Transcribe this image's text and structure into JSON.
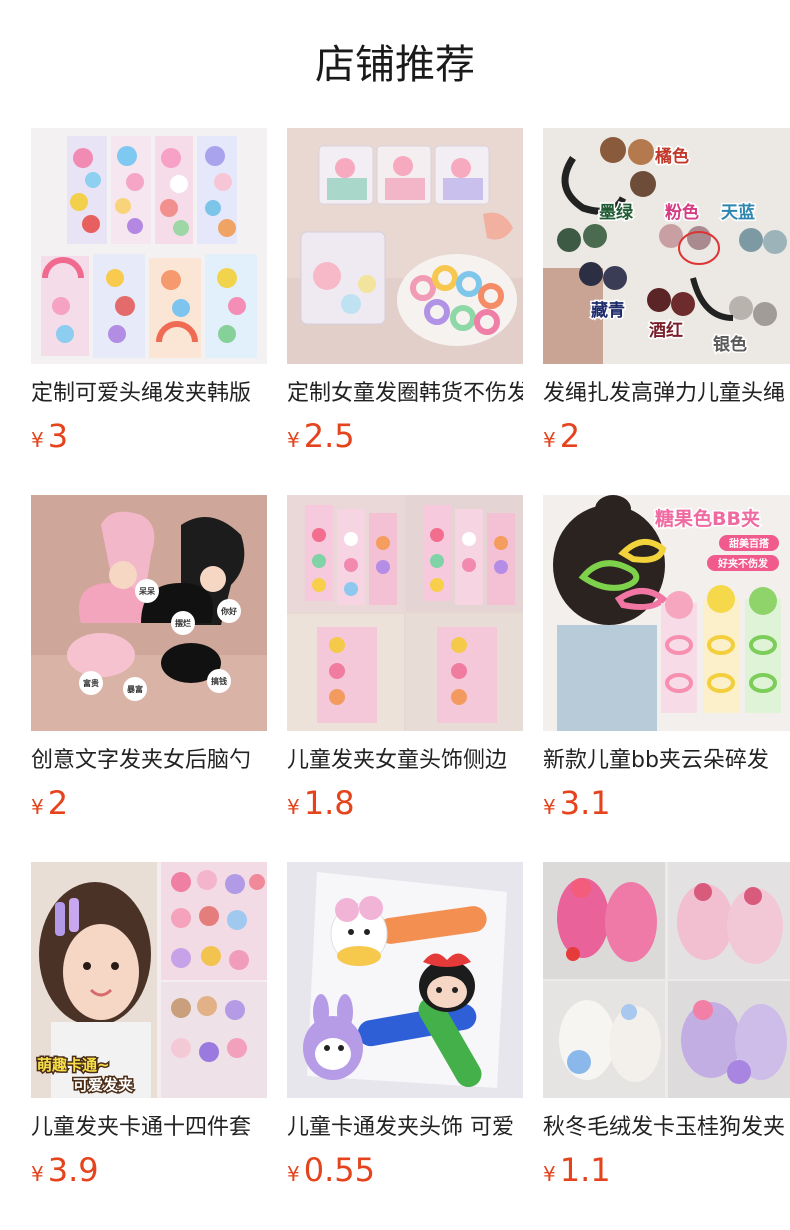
{
  "header": {
    "title": "店铺推荐"
  },
  "currency": "¥",
  "products": [
    {
      "name": "定制可爱头绳发夹韩版",
      "price": "3"
    },
    {
      "name": "定制女童发圈韩货不伤发",
      "price": "2.5"
    },
    {
      "name": "发绳扎发高弹力儿童头绳",
      "price": "2"
    },
    {
      "name": "创意文字发夹女后脑勺",
      "price": "2"
    },
    {
      "name": "儿童发夹女童头饰侧边",
      "price": "1.8"
    },
    {
      "name": "新款儿童bb夹云朵碎发",
      "price": "3.1"
    },
    {
      "name": "儿童发夹卡通十四件套",
      "price": "3.9"
    },
    {
      "name": "儿童卡通发夹头饰 可爱",
      "price": "0.55"
    },
    {
      "name": "秋冬毛绒发卡玉桂狗发夹",
      "price": "1.1"
    }
  ],
  "image_text": {
    "p3_labels": [
      "橘色",
      "墨绿",
      "粉色",
      "天蓝",
      "藏青",
      "酒红",
      "银色"
    ],
    "p4_tags": [
      "呆呆",
      "你好",
      "摆烂",
      "富贵",
      "暴富",
      "搞钱"
    ],
    "p6_banner": "糖果色BB夹",
    "p6_tags": [
      "甜美百搭",
      "好夹不伤发"
    ],
    "p7_caption": [
      "萌趣卡通~",
      "可爱发夹"
    ]
  }
}
